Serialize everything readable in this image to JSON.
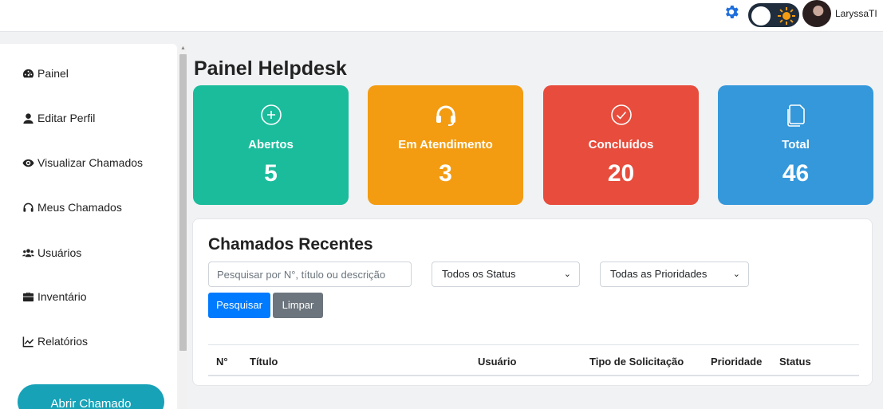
{
  "topbar": {
    "username": "LaryssaTI",
    "icons": {
      "settings": "gear-icon",
      "theme": "sun-icon"
    }
  },
  "sidebar": {
    "items": [
      {
        "label": "Painel",
        "icon": "dashboard-icon"
      },
      {
        "label": "Editar Perfil",
        "icon": "user-icon"
      },
      {
        "label": "Visualizar Chamados",
        "icon": "eye-icon"
      },
      {
        "label": "Meus Chamados",
        "icon": "headset-icon"
      },
      {
        "label": "Usuários",
        "icon": "users-icon"
      },
      {
        "label": "Inventário",
        "icon": "briefcase-icon"
      },
      {
        "label": "Relatórios",
        "icon": "chart-line-icon"
      }
    ],
    "open_ticket_label": "Abrir Chamado"
  },
  "main": {
    "title": "Painel Helpdesk",
    "cards": [
      {
        "label": "Abertos",
        "value": "5",
        "color": "#1abc9c",
        "icon": "plus-circle-icon"
      },
      {
        "label": "Em Atendimento",
        "value": "3",
        "color": "#f39c12",
        "icon": "headset-icon"
      },
      {
        "label": "Concluídos",
        "value": "20",
        "color": "#e74c3c",
        "icon": "check-circle-icon"
      },
      {
        "label": "Total",
        "value": "46",
        "color": "#3498db",
        "icon": "files-icon"
      }
    ],
    "recent": {
      "title": "Chamados Recentes",
      "search_placeholder": "Pesquisar por N°, título ou descrição",
      "status_select": "Todos os Status",
      "priority_select": "Todas as Prioridades",
      "search_label": "Pesquisar",
      "clear_label": "Limpar",
      "columns": [
        "N°",
        "Título",
        "Usuário",
        "Tipo de Solicitação",
        "Prioridade",
        "Status"
      ]
    }
  },
  "colors": {
    "primary": "#007bff",
    "secondary": "#6c757d",
    "accent": "#17a2b8"
  }
}
